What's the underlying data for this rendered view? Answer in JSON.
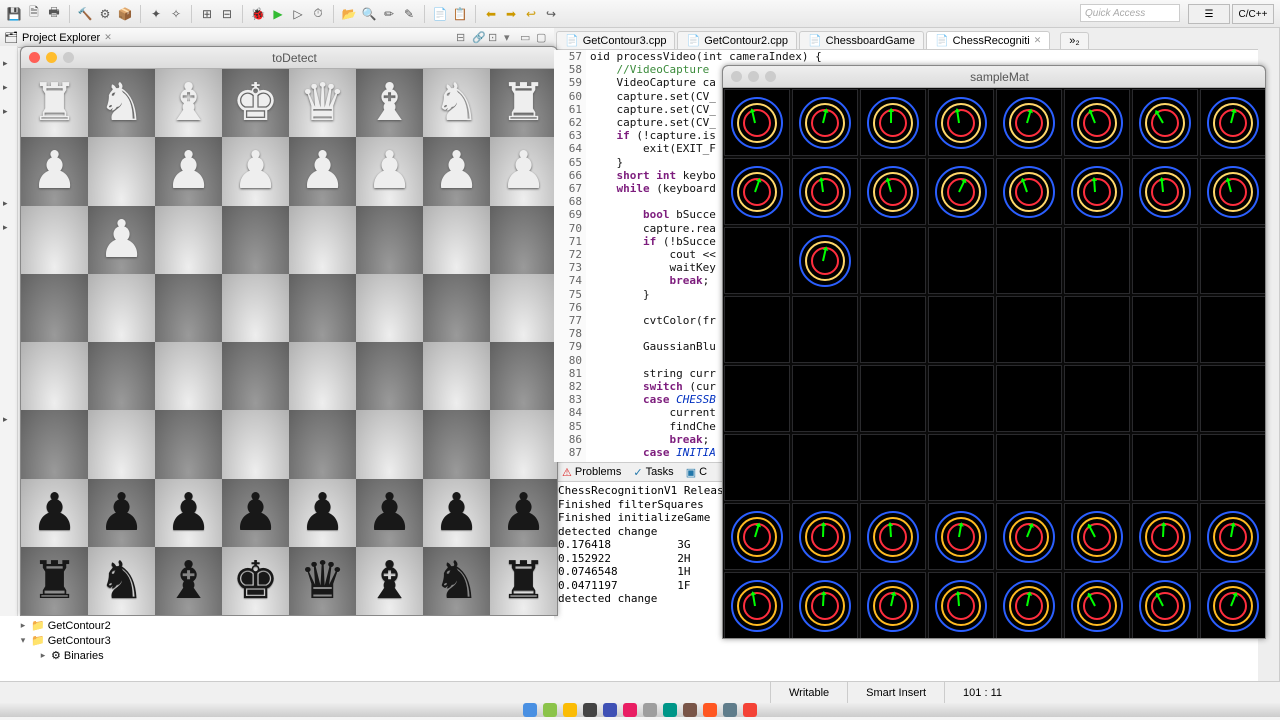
{
  "toolbar": {
    "quick_access": "Quick Access",
    "c_cpp": "C/C++"
  },
  "project_explorer": {
    "label": "Project Explorer"
  },
  "todetect_title": "toDetect",
  "samplemat_title": "sampleMat",
  "editor_tabs": [
    {
      "label": "GetContour3.cpp"
    },
    {
      "label": "GetContour2.cpp"
    },
    {
      "label": "ChessboardGame"
    },
    {
      "label": "ChessRecogniti",
      "active": true
    }
  ],
  "code_lines": [
    {
      "n": 57,
      "t": "oid processVideo(int cameraIndex) {",
      "frag": true
    },
    {
      "n": 58,
      "t": "    //VideoCapture",
      "cls": "cm"
    },
    {
      "n": 59,
      "t": "    VideoCapture ca"
    },
    {
      "n": 60,
      "t": "    capture.set(CV_"
    },
    {
      "n": 61,
      "t": "    capture.set(CV_"
    },
    {
      "n": 62,
      "t": "    capture.set(CV_"
    },
    {
      "n": 63,
      "t": "    if (!capture.is",
      "kw": "if"
    },
    {
      "n": 64,
      "t": "        exit(EXIT_F"
    },
    {
      "n": 65,
      "t": "    }"
    },
    {
      "n": 66,
      "t": "    short int keybo",
      "kw": "short int"
    },
    {
      "n": 67,
      "t": "    while (keyboard",
      "kw": "while"
    },
    {
      "n": 68,
      "t": ""
    },
    {
      "n": 69,
      "t": "        bool bSucce",
      "kw": "bool"
    },
    {
      "n": 70,
      "t": "        capture.rea"
    },
    {
      "n": 71,
      "t": "        if (!bSucce",
      "kw": "if"
    },
    {
      "n": 72,
      "t": "            cout <<"
    },
    {
      "n": 73,
      "t": "            waitKey"
    },
    {
      "n": 74,
      "t": "            break;",
      "kw": "break"
    },
    {
      "n": 75,
      "t": "        }"
    },
    {
      "n": 76,
      "t": ""
    },
    {
      "n": 77,
      "t": "        cvtColor(fr"
    },
    {
      "n": 78,
      "t": ""
    },
    {
      "n": 79,
      "t": "        GaussianBlu"
    },
    {
      "n": 80,
      "t": ""
    },
    {
      "n": 81,
      "t": "        string curr"
    },
    {
      "n": 82,
      "t": "        switch (cur",
      "kw": "switch"
    },
    {
      "n": 83,
      "t": "        case CHESSB",
      "kw": "case",
      "co": "CHESSB"
    },
    {
      "n": 84,
      "t": "            current"
    },
    {
      "n": 85,
      "t": "            findChe"
    },
    {
      "n": 86,
      "t": "            break;",
      "kw": "break"
    },
    {
      "n": 87,
      "t": "        case INITIA",
      "kw": "case",
      "co": "INITIA"
    }
  ],
  "bottom_tabs": {
    "problems": "Problems",
    "tasks": "Tasks",
    "console": "C"
  },
  "console": [
    "ChessRecognitionV1 Release",
    "Finished filterSquares",
    "Finished initializeGame",
    "detected change",
    "0.176418          3G",
    "0.152922          2H",
    "0.0746548         1H",
    "0.0471197         1F",
    "detected change"
  ],
  "tree": [
    {
      "label": "GetContour2",
      "icon": "📁"
    },
    {
      "label": "GetContour3",
      "icon": "📁",
      "open": true
    },
    {
      "label": "Binaries",
      "icon": "⚙",
      "indent": true
    }
  ],
  "board": [
    [
      "wr",
      "wn",
      "wb",
      "wk",
      "wq",
      "wb",
      "wn",
      "wr"
    ],
    [
      "wp",
      "",
      "wp",
      "wp",
      "wp",
      "wp",
      "wp",
      "wp"
    ],
    [
      "",
      "wp",
      "",
      "",
      "",
      "",
      "",
      ""
    ],
    [
      "",
      "",
      "",
      "",
      "",
      "",
      "",
      ""
    ],
    [
      "",
      "",
      "",
      "",
      "",
      "",
      "",
      ""
    ],
    [
      "",
      "",
      "",
      "",
      "",
      "",
      "",
      ""
    ],
    [
      "bp",
      "bp",
      "bp",
      "bp",
      "bp",
      "bp",
      "bp",
      "bp"
    ],
    [
      "br",
      "bn",
      "bb",
      "bk",
      "bq",
      "bb",
      "bn",
      "br"
    ]
  ],
  "cv_pieces_rows": [
    0,
    1,
    6,
    7
  ],
  "cv_extra": {
    "r": 2,
    "c": 1
  },
  "status": {
    "writable": "Writable",
    "insert": "Smart Insert",
    "pos": "101 : 11"
  }
}
